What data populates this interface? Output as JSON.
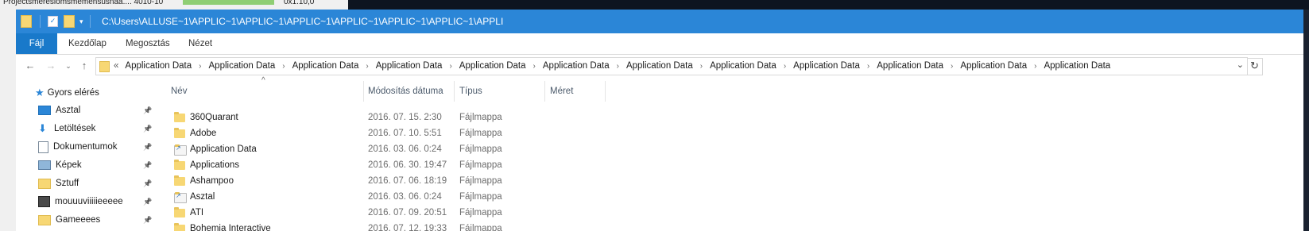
{
  "background": {
    "text": "Projectsmeresiomsmemensusnaa.... 4010-10",
    "right_text": "0x1.10,0"
  },
  "window": {
    "title_path": "C:\\Users\\ALLUSE~1\\APPLIC~1\\APPLIC~1\\APPLIC~1\\APPLIC~1\\APPLIC~1\\APPLIC~1\\APPLI",
    "accent_color": "#2b86d7"
  },
  "ribbon": {
    "tabs": [
      {
        "label": "Fájl"
      },
      {
        "label": "Kezdőlap"
      },
      {
        "label": "Megosztás"
      },
      {
        "label": "Nézet"
      }
    ]
  },
  "address_bar": {
    "overflow": "«",
    "crumbs": [
      "Application Data",
      "Application Data",
      "Application Data",
      "Application Data",
      "Application Data",
      "Application Data",
      "Application Data",
      "Application Data",
      "Application Data",
      "Application Data",
      "Application Data",
      "Application Data"
    ]
  },
  "nav_pane": {
    "quick_access": "Gyors elérés",
    "items": [
      {
        "label": "Asztal",
        "icon": "desktop-icon"
      },
      {
        "label": "Letöltések",
        "icon": "download-icon"
      },
      {
        "label": "Dokumentumok",
        "icon": "documents-icon"
      },
      {
        "label": "Képek",
        "icon": "pictures-icon"
      },
      {
        "label": "Sztuff",
        "icon": "folder-icon"
      },
      {
        "label": "mouuuviiiiieeeee",
        "icon": "video-folder-icon"
      },
      {
        "label": "Gameeees",
        "icon": "folder-icon"
      }
    ]
  },
  "columns": {
    "name": "Név",
    "date": "Módosítás dátuma",
    "type": "Típus",
    "size": "Méret"
  },
  "files": [
    {
      "name": "360Quarant",
      "date": "2016. 07. 15. 2:30",
      "type": "Fájlmappa",
      "shortcut": false
    },
    {
      "name": "Adobe",
      "date": "2016. 07. 10. 5:51",
      "type": "Fájlmappa",
      "shortcut": false
    },
    {
      "name": "Application Data",
      "date": "2016. 03. 06. 0:24",
      "type": "Fájlmappa",
      "shortcut": true
    },
    {
      "name": "Applications",
      "date": "2016. 06. 30. 19:47",
      "type": "Fájlmappa",
      "shortcut": false
    },
    {
      "name": "Ashampoo",
      "date": "2016. 07. 06. 18:19",
      "type": "Fájlmappa",
      "shortcut": false
    },
    {
      "name": "Asztal",
      "date": "2016. 03. 06. 0:24",
      "type": "Fájlmappa",
      "shortcut": true
    },
    {
      "name": "ATI",
      "date": "2016. 07. 09. 20:51",
      "type": "Fájlmappa",
      "shortcut": false
    },
    {
      "name": "Bohemia Interactive",
      "date": "2016. 07. 12. 19:33",
      "type": "Fájlmappa",
      "shortcut": false
    }
  ]
}
